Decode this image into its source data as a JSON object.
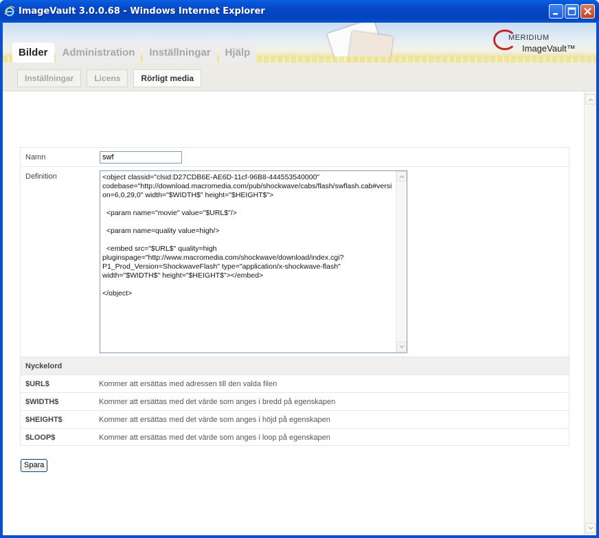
{
  "window": {
    "title": "ImageVault 3.0.0.68 - Windows Internet Explorer"
  },
  "logo": {
    "company": "MERIDIUM",
    "product": "ImageVault™"
  },
  "tabs": [
    {
      "label": "Bilder",
      "active": true
    },
    {
      "label": "Administration",
      "active": false
    },
    {
      "label": "Inställningar",
      "active": false
    },
    {
      "label": "Hjälp",
      "active": false
    }
  ],
  "subtabs": [
    {
      "label": "Inställningar",
      "active": false
    },
    {
      "label": "Licens",
      "active": false
    },
    {
      "label": "Rörligt media",
      "active": true
    }
  ],
  "form": {
    "name_label": "Namn",
    "name_value": "swf",
    "definition_label": "Definition",
    "definition_value": "<object classid=\"clsid:D27CDB6E-AE6D-11cf-96B8-444553540000\"\ncodebase=\"http://download.macromedia.com/pub/shockwave/cabs/flash/swflash.cab#version=6,0,29,0\" width=\"$WIDTH$\" height=\"$HEIGHT$\">\n\n  <param name=\"movie\" value=\"$URL$\"/>\n\n  <param name=quality value=high/>\n\n  <embed src=\"$URL$\" quality=high\npluginspage=\"http://www.macromedia.com/shockwave/download/index.cgi?P1_Prod_Version=ShockwaveFlash\" type=\"application/x-shockwave-flash\"\nwidth=\"$WIDTH$\" height=\"$HEIGHT$\"></embed>\n\n</object>"
  },
  "keywords": {
    "header": "Nyckelord",
    "rows": [
      {
        "key": "$URL$",
        "desc": "Kommer att ersättas med adressen till den valda filen"
      },
      {
        "key": "$WIDTH$",
        "desc": "Kommer att ersättas med det värde som anges i bredd på egenskapen"
      },
      {
        "key": "$HEIGHT$",
        "desc": "Kommer att ersättas med det värde som anges i höjd på egenskapen"
      },
      {
        "key": "$LOOP$",
        "desc": "Kommer att ersättas med det värde som anges i loop på egenskapen"
      }
    ]
  },
  "buttons": {
    "save": "Spara"
  },
  "icons": {
    "browser": "ie-icon",
    "minimize": "minimize-icon",
    "maximize": "maximize-icon",
    "close": "close-icon"
  }
}
